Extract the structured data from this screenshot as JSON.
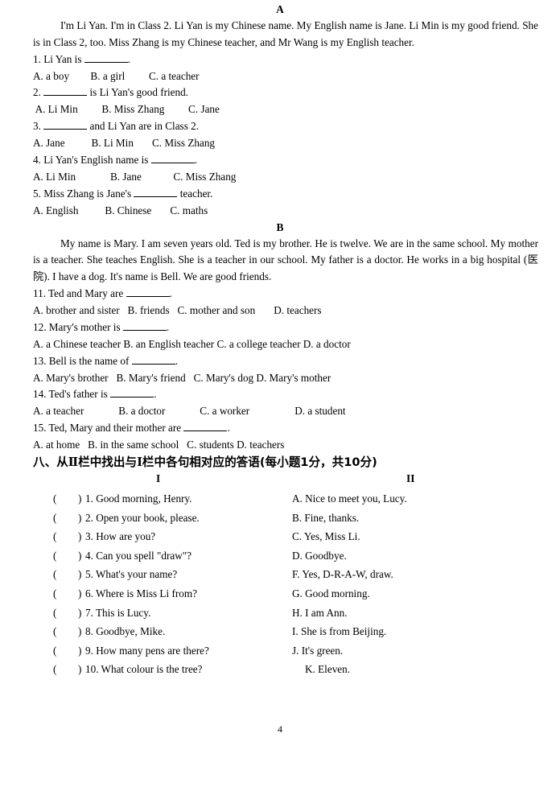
{
  "page": {
    "number": "4"
  },
  "sections": [
    {
      "letter": "A",
      "passage": "I'm Li Yan. I'm in Class 2. Li Yan is my Chinese name. My English name is Jane. Li Min is my good friend. She is in Class 2, too. Miss Zhang is my Chinese teacher, and Mr Wang is my English teacher.",
      "questions": [
        {
          "stem_before": "1. Li Yan is ",
          "stem_after": ".",
          "options": "A. a boy        B. a girl         C. a teacher",
          "options_indent": false
        },
        {
          "stem_before": "2. ",
          "stem_after": " is Li Yan's good friend.",
          "options": " A. Li Min         B. Miss Zhang         C. Jane",
          "options_indent": false
        },
        {
          "stem_before": "3. ",
          "stem_after": " and Li Yan are in Class 2.",
          "options": "A. Jane          B. Li Min       C. Miss Zhang",
          "options_indent": false
        },
        {
          "stem_before": "4. Li Yan's English name is ",
          "stem_after": ".",
          "options": "A. Li Min             B. Jane            C. Miss Zhang",
          "options_indent": false
        },
        {
          "stem_before": "5. Miss Zhang is Jane's ",
          "stem_after": " teacher.",
          "options": "A. English          B. Chinese       C. maths",
          "options_indent": false
        }
      ]
    },
    {
      "letter": "B",
      "passage": "My name is Mary. I am seven years old. Ted is my brother. He is twelve. We are in the same school. My mother is a teacher. She teaches English. She is a teacher in our school. My father is a doctor. He works in a big hospital (医院). I have a dog. It's name is Bell. We are good friends.",
      "questions": [
        {
          "stem_before": "11. Ted and Mary are ",
          "stem_after": ".",
          "options": "A. brother and sister   B. friends   C. mother and son       D. teachers",
          "options_indent": false
        },
        {
          "stem_before": "12. Mary's mother is ",
          "stem_after": ".",
          "options": "A. a Chinese teacher B. an English teacher C. a college teacher D. a doctor",
          "options_indent": false
        },
        {
          "stem_before": "13. Bell is the name of ",
          "stem_after": ".",
          "options": "A. Mary's brother   B. Mary's friend   C. Mary's dog D. Mary's mother",
          "options_indent": false
        },
        {
          "stem_before": "14. Ted's father is ",
          "stem_after": ".",
          "options": "A. a teacher             B. a doctor             C. a worker                 D. a student",
          "options_indent": false
        },
        {
          "stem_before": "15. Ted, Mary and their mother are ",
          "stem_after": ".",
          "options": "A. at home   B. in the same school   C. students D. teachers",
          "options_indent": false
        }
      ]
    }
  ],
  "matching_exercise": {
    "heading_parts": {
      "p1": "八、从",
      "roman1": "Ⅱ",
      "p2": "栏中找出与",
      "roman2": "Ⅰ",
      "p3": "栏中各句相对应的答语(每小题1分，共10分)"
    },
    "column_headers": {
      "left": "I",
      "right": "II"
    },
    "paren_open": "(",
    "paren_close": ")",
    "left_items": [
      "1. Good morning, Henry.",
      "2. Open your book, please.",
      "3. How are you?",
      "4. Can you spell \"draw\"?",
      "5. What's your name?",
      "6. Where is Miss Li from?",
      "7. This is Lucy.",
      "8. Goodbye, Mike.",
      "9. How many pens are there?",
      "10. What colour is the tree?"
    ],
    "right_items": [
      {
        "text": "A. Nice to meet you, Lucy.",
        "shifted": false
      },
      {
        "text": "B. Fine, thanks.",
        "shifted": false
      },
      {
        "text": "C. Yes, Miss Li.",
        "shifted": false
      },
      {
        "text": "D. Goodbye.",
        "shifted": false
      },
      {
        "text": "F. Yes, D-R-A-W, draw.",
        "shifted": false
      },
      {
        "text": "G. Good morning.",
        "shifted": false
      },
      {
        "text": "H. I am Ann.",
        "shifted": false
      },
      {
        "text": "I. She is from Beijing.",
        "shifted": false
      },
      {
        "text": "J. It's green.",
        "shifted": false
      },
      {
        "text": "K. Eleven.",
        "shifted": true
      }
    ]
  }
}
